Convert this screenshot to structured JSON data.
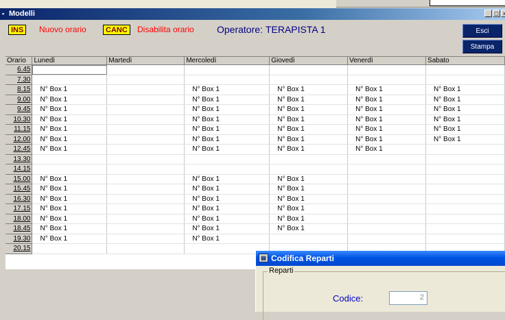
{
  "window": {
    "title": "Modelli",
    "controls": [
      "_",
      "□",
      "×"
    ]
  },
  "legend_bar": {
    "ins_key": "INS",
    "ins_text": "Nuovo orario",
    "canc_key": "CANC",
    "canc_text": "Disabilita orario",
    "operator_label": "Operatore:",
    "operator_name": "TERAPISTA 1"
  },
  "buttons": {
    "esci": "Esci",
    "stampa": "Stampa"
  },
  "grid": {
    "columns": [
      "Orario",
      "Lunedì",
      "Martedì",
      "Mercoledì",
      "Giovedì",
      "Venerdì",
      "Sabato"
    ],
    "rows": [
      [
        "6.45",
        "",
        "",
        "",
        "",
        "",
        ""
      ],
      [
        "7.30",
        "",
        "",
        "",
        "",
        "",
        ""
      ],
      [
        "8.15",
        "N° Box 1",
        "",
        "N° Box 1",
        "N° Box 1",
        "N° Box 1",
        "N° Box 1"
      ],
      [
        "9.00",
        "N° Box 1",
        "",
        "N° Box 1",
        "N° Box 1",
        "N° Box 1",
        "N° Box 1"
      ],
      [
        "9.45",
        "N° Box 1",
        "",
        "N° Box 1",
        "N° Box 1",
        "N° Box 1",
        "N° Box 1"
      ],
      [
        "10.30",
        "N° Box 1",
        "",
        "N° Box 1",
        "N° Box 1",
        "N° Box 1",
        "N° Box 1"
      ],
      [
        "11.15",
        "N° Box 1",
        "",
        "N° Box 1",
        "N° Box 1",
        "N° Box 1",
        "N° Box 1"
      ],
      [
        "12.00",
        "N° Box 1",
        "",
        "N° Box 1",
        "N° Box 1",
        "N° Box 1",
        "N° Box 1"
      ],
      [
        "12.45",
        "N° Box 1",
        "",
        "N° Box 1",
        "N° Box 1",
        "N° Box 1",
        ""
      ],
      [
        "13.30",
        "",
        "",
        "",
        "",
        "",
        ""
      ],
      [
        "14.15",
        "",
        "",
        "",
        "",
        "",
        ""
      ],
      [
        "15.00",
        "N° Box 1",
        "",
        "N° Box 1",
        "N° Box 1",
        "",
        ""
      ],
      [
        "15.45",
        "N° Box 1",
        "",
        "N° Box 1",
        "N° Box 1",
        "",
        ""
      ],
      [
        "16.30",
        "N° Box 1",
        "",
        "N° Box 1",
        "N° Box 1",
        "",
        ""
      ],
      [
        "17.15",
        "N° Box 1",
        "",
        "N° Box 1",
        "N° Box 1",
        "",
        ""
      ],
      [
        "18.00",
        "N° Box 1",
        "",
        "N° Box 1",
        "N° Box 1",
        "",
        ""
      ],
      [
        "18.45",
        "N° Box 1",
        "",
        "N° Box 1",
        "N° Box 1",
        "",
        ""
      ],
      [
        "19.30",
        "N° Box 1",
        "",
        "N° Box 1",
        "",
        "",
        ""
      ],
      [
        "20.15",
        "",
        "",
        "",
        "",
        "",
        ""
      ]
    ]
  },
  "dialog": {
    "title": "Codifica Reparti",
    "group_label": "Reparti",
    "codice_label": "Codice:",
    "codice_value": "2"
  },
  "colors": {
    "title_bar": "#0a246a",
    "badge": "#ffff00",
    "red_text": "#ff0000",
    "operator": "#000080",
    "dialog_title": "#0054e3"
  },
  "icons": {
    "window": "app-icon",
    "dialog": "dialog-icon"
  }
}
